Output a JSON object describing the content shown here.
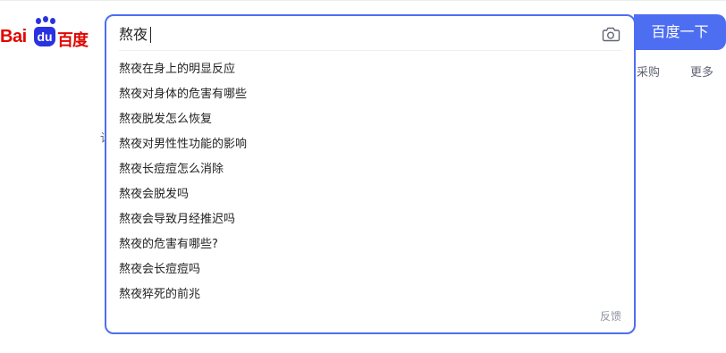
{
  "logo": {
    "latin": "Bai",
    "badge": "du",
    "cn": "百度"
  },
  "search": {
    "query": "熬夜",
    "search_button_label": "百度一下",
    "feedback_label": "反馈",
    "suggestions": [
      {
        "prefix": "熬夜",
        "rest": "在身上的明显反应"
      },
      {
        "prefix": "熬夜",
        "rest": "对身体的危害有哪些"
      },
      {
        "prefix": "熬夜",
        "rest": "脱发怎么恢复"
      },
      {
        "prefix": "熬夜",
        "rest": "对男性性功能的影响"
      },
      {
        "prefix": "熬夜",
        "rest": "长痘痘怎么消除"
      },
      {
        "prefix": "熬夜",
        "rest": "会脱发吗"
      },
      {
        "prefix": "熬夜",
        "rest": "会导致月经推迟吗"
      },
      {
        "prefix": "熬夜",
        "rest": "的危害有哪些?"
      },
      {
        "prefix": "熬夜",
        "rest": "会长痘痘吗"
      },
      {
        "prefix": "熬夜",
        "rest": "猝死的前兆"
      }
    ]
  },
  "nav": {
    "purchase_label": "采购",
    "more_label": "更多",
    "partial_char": "诮"
  },
  "colors": {
    "accent": "#4e6ef2",
    "brand_red": "#e10601",
    "brand_blue": "#2932e1"
  },
  "icons": {
    "camera": "camera-icon"
  }
}
